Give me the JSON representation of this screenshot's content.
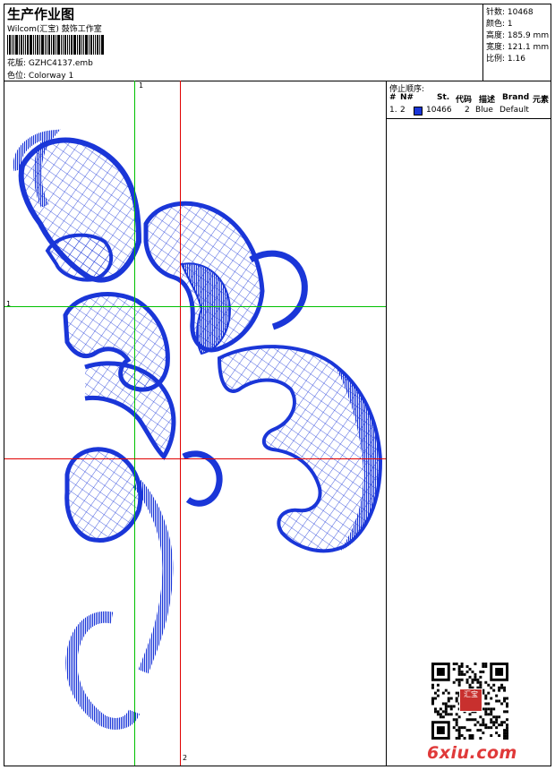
{
  "header": {
    "title": "生产作业图",
    "subtitle": "Wilcom(汇宝) 鼓饰工作室",
    "design_label": "花版:",
    "design_value": "GZHC4137.emb",
    "color_label": "色位:",
    "color_value": "Colorway 1"
  },
  "stats": {
    "stitches_label": "针数:",
    "stitches": "10468",
    "colors_label": "颜色:",
    "colors": "1",
    "height_label": "高度:",
    "height": "185.9 mm",
    "width_label": "宽度:",
    "width": "121.1 mm",
    "ratio_label": "比例:",
    "ratio": "1.16"
  },
  "stop_sequence": {
    "title": "停止顺序:",
    "columns": [
      "#",
      "N#",
      "St.",
      "代码",
      "描述",
      "Brand",
      "元素"
    ],
    "rows": [
      {
        "index": "1.",
        "needle": "2",
        "swatch_color": "#1a36d8",
        "stitches": "10466",
        "code": "2",
        "description": "Blue",
        "brand": "Default",
        "element": ""
      }
    ]
  },
  "canvas": {
    "marker_top": "1",
    "marker_left": "1",
    "marker_bottom": "2",
    "guide_green": "#00c000",
    "guide_red": "#e00000",
    "stitch_color": "#1a36d8"
  },
  "watermark": {
    "seal_text": "汇宝",
    "site": "6xiu.com"
  }
}
